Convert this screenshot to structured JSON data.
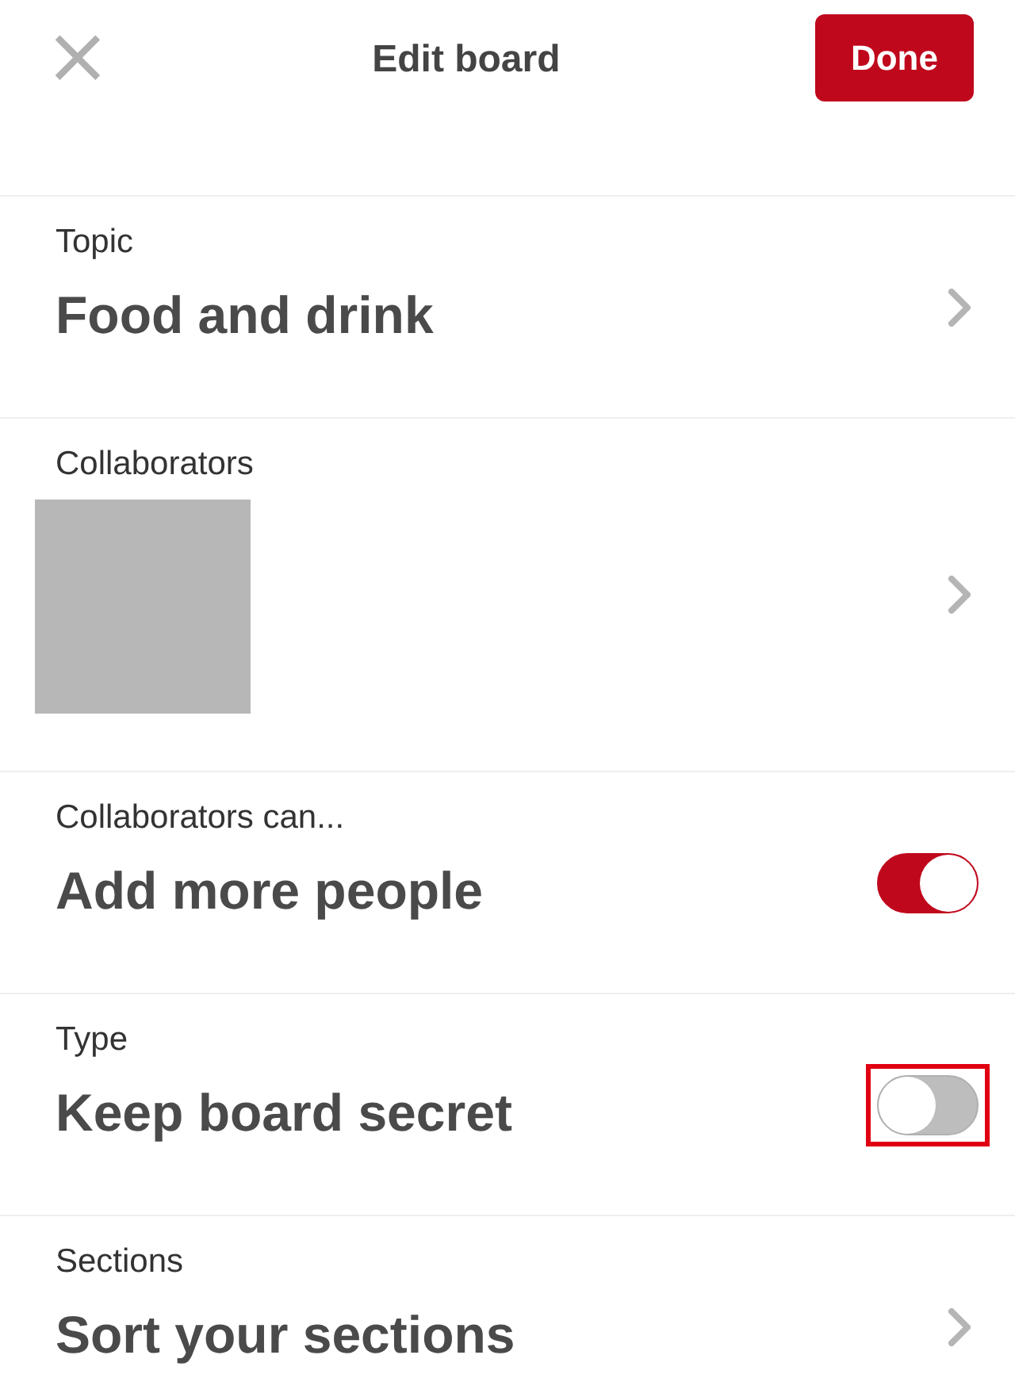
{
  "header": {
    "title": "Edit board",
    "done": "Done",
    "close": "×"
  },
  "rows": [
    {
      "kind": "chevron",
      "label": "Topic",
      "value": "Food and drink"
    },
    {
      "kind": "collaborators",
      "label": "Collaborators"
    },
    {
      "kind": "toggle",
      "label": "Collaborators can...",
      "value": "Add more people",
      "on": true,
      "highlighted": false
    },
    {
      "kind": "toggle",
      "label": "Type",
      "value": "Keep board secret",
      "on": false,
      "highlighted": true
    },
    {
      "kind": "chevron",
      "label": "Sections",
      "value": "Sort your sections"
    }
  ]
}
